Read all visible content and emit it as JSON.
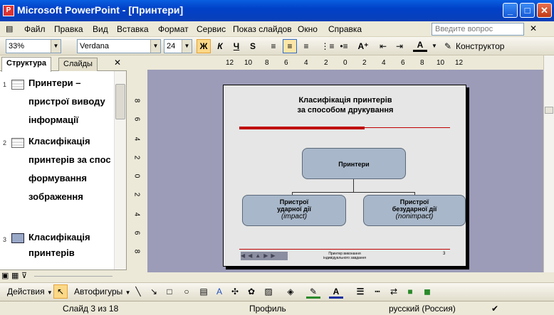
{
  "window": {
    "title": "Microsoft PowerPoint - [Принтери]",
    "app_icon": "P"
  },
  "menu": {
    "items": [
      "Файл",
      "Правка",
      "Вид",
      "Вставка",
      "Формат",
      "Сервис",
      "Показ слайдов",
      "Окно",
      "Справка"
    ],
    "help_placeholder": "Введите вопрос"
  },
  "toolbar": {
    "zoom": "33%",
    "font": "Verdana",
    "font_size": "24",
    "bold": "Ж",
    "italic": "К",
    "underline": "Ч",
    "shadow": "S",
    "designer": "Конструктор"
  },
  "ruler": {
    "h_ticks": [
      "12",
      "10",
      "8",
      "6",
      "4",
      "2",
      "0",
      "2",
      "4",
      "6",
      "8",
      "10",
      "12"
    ],
    "v_ticks": [
      "8",
      "6",
      "4",
      "2",
      "0",
      "2",
      "4",
      "6",
      "8"
    ]
  },
  "panel": {
    "tabs": [
      "Структура",
      "Слайды"
    ],
    "outline": [
      {
        "num": "1",
        "lines": [
          "Принтери –",
          "пристрої виводу",
          "інформації"
        ]
      },
      {
        "num": "2",
        "lines": [
          "Класифікація",
          "принтерів за спос",
          "формування",
          "зображення"
        ]
      },
      {
        "num": "3",
        "lines": [
          "Класифікація",
          "принтерів"
        ]
      }
    ]
  },
  "slide": {
    "title_line1": "Класифікація принтерів",
    "title_line2": "за способом друкування",
    "root": "Принтери",
    "left_line1": "Пристрої",
    "left_line2": "ударної дії",
    "left_line3": "(impact)",
    "right_line1": "Пристрої",
    "right_line2": "безударної дії",
    "right_line3": "(nonimpact)",
    "footer_line1": "Принтер виконання",
    "footer_line2": "індивідуального завдання",
    "page_num": "3"
  },
  "draw": {
    "actions": "Действия",
    "autoshapes": "Автофигуры"
  },
  "status": {
    "slide": "Слайд 3 из 18",
    "design": "Профиль",
    "lang": "русский (Россия)"
  },
  "colors": {
    "accent_red": "#c00000",
    "node_fill": "#a8b7c9",
    "slide_bg": "#e6e6e6"
  }
}
